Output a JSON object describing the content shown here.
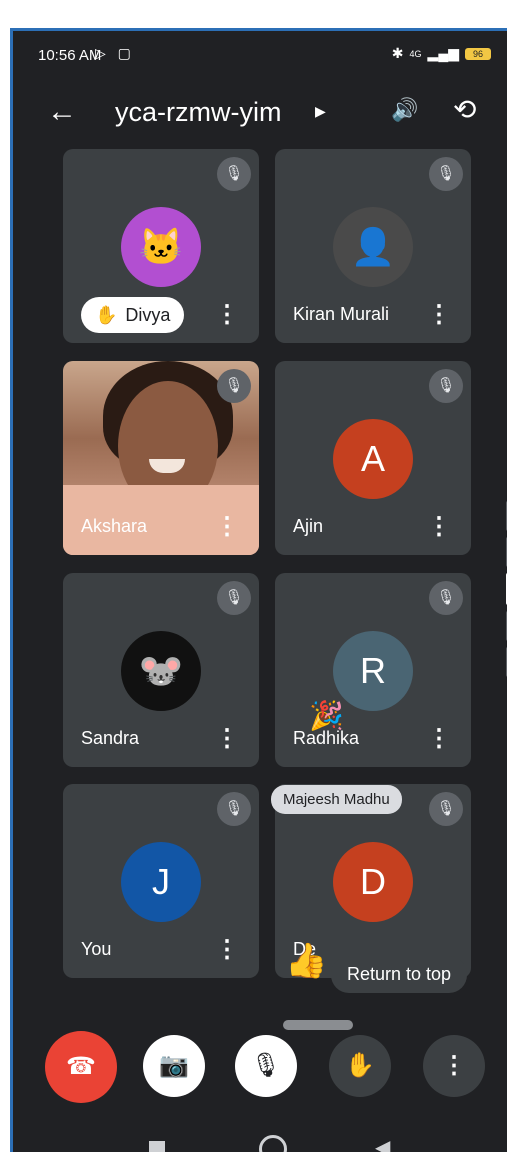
{
  "status_bar": {
    "time": "10:56 AM",
    "network": "4G",
    "battery": "96"
  },
  "header": {
    "meeting_code": "yca-rzmw-yim"
  },
  "participants": [
    {
      "name": "Divya",
      "initial": "",
      "mic": "muted",
      "avatar_color": "#b24fd1",
      "hand_raised": true
    },
    {
      "name": "Kiran Murali",
      "initial": "",
      "mic": "muted",
      "avatar_color": "#4a4a4a",
      "hand_raised": false
    },
    {
      "name": "Akshara",
      "initial": "",
      "mic": "muted",
      "video": true,
      "hand_raised": false
    },
    {
      "name": "Ajin",
      "initial": "A",
      "mic": "muted",
      "avatar_color": "#c5401f",
      "hand_raised": false
    },
    {
      "name": "Sandra",
      "initial": "",
      "mic": "muted",
      "avatar_color": "#111111",
      "hand_raised": false
    },
    {
      "name": "Radhika",
      "initial": "R",
      "mic": "muted",
      "avatar_color": "#4a6573",
      "hand_raised": false
    },
    {
      "name": "You",
      "initial": "J",
      "mic": "muted",
      "avatar_color": "#1256a6",
      "hand_raised": false
    },
    {
      "name": "De",
      "initial": "D",
      "mic": "muted",
      "avatar_color": "#c5401f",
      "hand_raised": false
    }
  ],
  "overlays": {
    "tooltip": "Majeesh Madhu",
    "return_to_top": "Return to top"
  },
  "controls": {
    "end_call_color": "#ea4335"
  }
}
